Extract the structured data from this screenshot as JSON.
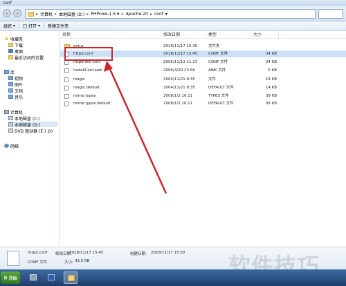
{
  "window": {
    "title": "conf"
  },
  "address": {
    "crumbs": [
      "计算机",
      "本地磁盘 (D:)",
      "PHPnow-1.5.6",
      "Apache-20",
      "conf"
    ],
    "separator": "▸"
  },
  "toolbar": {
    "organize": "组织",
    "open": "打开",
    "new_folder": "新建文件夹"
  },
  "nav": {
    "favorites": "收藏夹",
    "downloads": "下载",
    "desktop": "桌面",
    "recent": "最近访问的位置",
    "libraries": "库",
    "videos": "视频",
    "pictures": "图片",
    "documents": "文档",
    "music": "音乐",
    "computer": "计算机",
    "drive_c": "本地磁盘 (C:)",
    "drive_d": "本地磁盘 (D:)",
    "drive_e": "DVD 驱动器 (E:) 20",
    "network": "网络"
  },
  "columns": {
    "name": "名称",
    "date": "修改日期",
    "type": "类型",
    "size": "大小"
  },
  "files": [
    {
      "name": "extra",
      "date": "2018/11/17 15:30",
      "type": "文件夹",
      "size": ""
    },
    {
      "name": "httpd.conf",
      "date": "2018/11/17 15:45",
      "type": "CONF 文件",
      "size": "34 KB"
    },
    {
      "name": "httpd-win.conf",
      "date": "2005/11/13 11:13",
      "type": "CONF 文件",
      "size": "24 KB"
    },
    {
      "name": "InstallConf.awk",
      "date": "2006/4/29 23:56",
      "type": "AWK 文件",
      "size": "5 KB"
    },
    {
      "name": "magic",
      "date": "2004/11/21 8:35",
      "type": "文件",
      "size": "14 KB"
    },
    {
      "name": "magic.default",
      "date": "2004/11/21 8:35",
      "type": "DEFAULT 文件",
      "size": "14 KB"
    },
    {
      "name": "mime.types",
      "date": "2008/1/2 16:11",
      "type": "TYPES 文件",
      "size": "39 KB"
    },
    {
      "name": "mime.types.default",
      "date": "2008/1/2 16:11",
      "type": "DEFAULT 文件",
      "size": "39 KB"
    }
  ],
  "details": {
    "filename": "httpd.conf",
    "modified_label": "修改日期:",
    "modified": "2018/11/17 15:45",
    "created_label": "创建日期:",
    "created": "2018/11/17 15:30",
    "type": "CONF 文件",
    "size_label": "大小:",
    "size": "33.5 KB"
  },
  "taskbar": {
    "start": "开始"
  },
  "watermark": "软件技巧",
  "colors": {
    "highlight": "#c8252f",
    "selection": "#cce1f6"
  }
}
